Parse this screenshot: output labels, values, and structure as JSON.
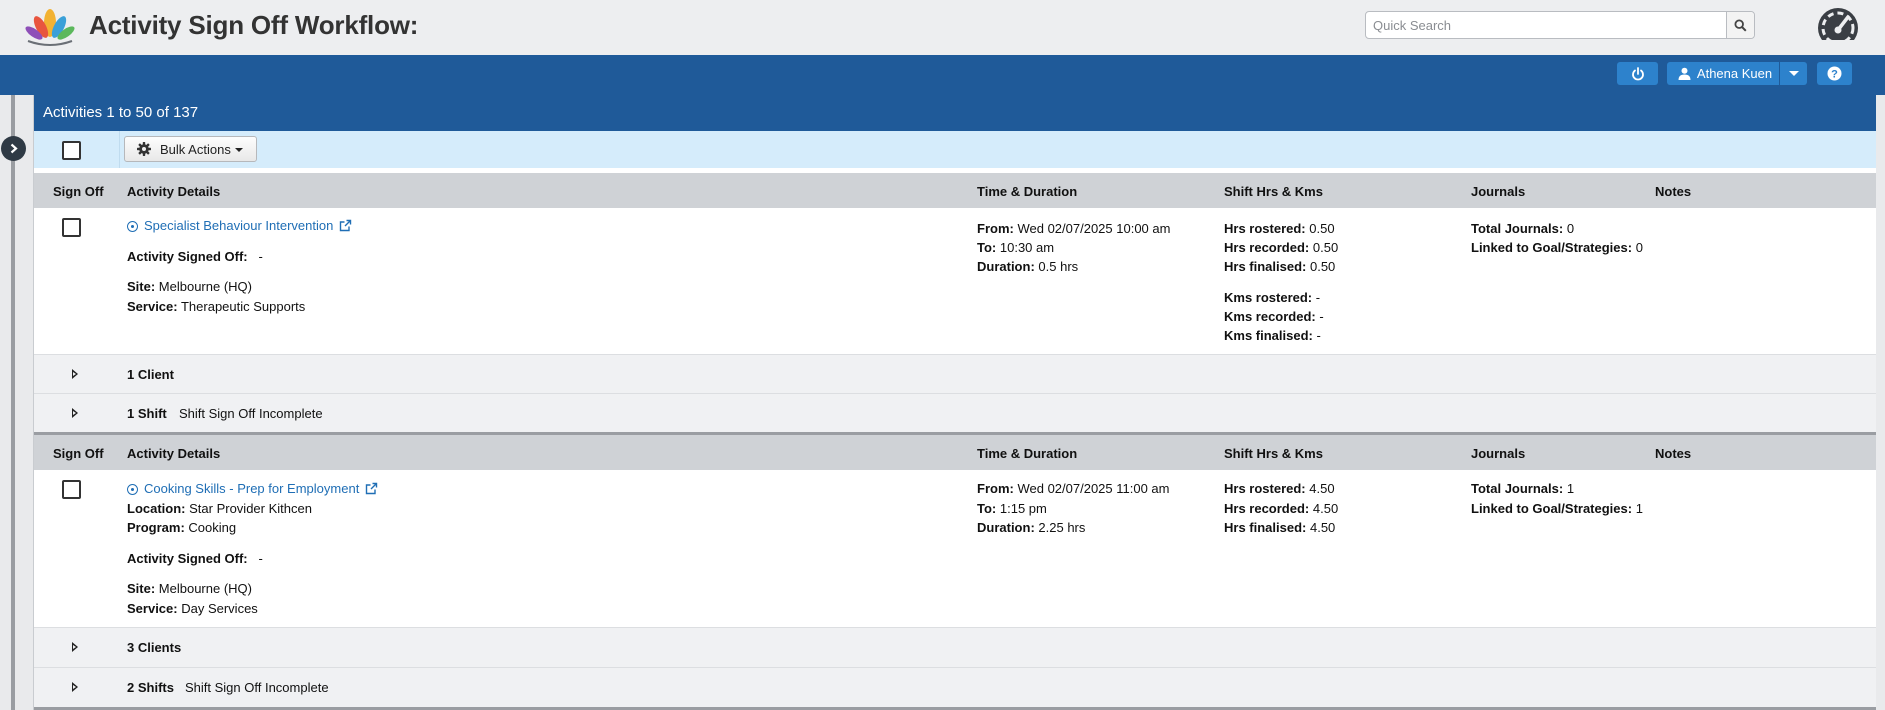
{
  "header": {
    "title": "Activity Sign Off Workflow:",
    "search_placeholder": "Quick Search",
    "logo_icon": "lotus-logo-icon",
    "dashboard_icon": "speedometer-icon"
  },
  "navbar": {
    "user_name": "Athena Kuen",
    "power_icon": "power-icon",
    "user_icon": "user-icon",
    "help_icon": "help-icon"
  },
  "panel": {
    "title": "Activities 1 to 50 of 137",
    "bulk_actions_label": "Bulk Actions"
  },
  "columns": {
    "sign_off": "Sign Off",
    "details": "Activity Details",
    "time": "Time & Duration",
    "shift": "Shift Hrs & Kms",
    "journals": "Journals",
    "notes": "Notes"
  },
  "labels": {
    "signed_off": "Activity Signed Off:",
    "site": "Site:",
    "service": "Service:",
    "location": "Location:",
    "program": "Program:",
    "from": "From:",
    "to": "To:",
    "duration": "Duration:",
    "hrs_rostered": "Hrs rostered:",
    "hrs_recorded": "Hrs recorded:",
    "hrs_finalised": "Hrs finalised:",
    "kms_rostered": "Kms rostered:",
    "kms_recorded": "Kms recorded:",
    "kms_finalised": "Kms finalised:",
    "total_journals": "Total Journals:",
    "linked_goals": "Linked to Goal/Strategies:"
  },
  "activities": [
    {
      "name": "Specialist Behaviour Intervention",
      "signed_off": "-",
      "site": "Melbourne (HQ)",
      "service": "Therapeutic Supports",
      "from": "Wed 02/07/2025 10:00 am",
      "to": "10:30 am",
      "duration": "0.5 hrs",
      "hrs_rostered": "0.50",
      "hrs_recorded": "0.50",
      "hrs_finalised": "0.50",
      "kms_rostered": "-",
      "kms_recorded": "-",
      "kms_finalised": "-",
      "total_journals": "0",
      "linked_goals": "0",
      "clients_label": "1 Client",
      "shifts_label": "1 Shift",
      "shift_status": "Shift Sign Off Incomplete"
    },
    {
      "name": "Cooking Skills - Prep for Employment",
      "location": "Star Provider Kithcen",
      "program": "Cooking",
      "signed_off": "-",
      "site": "Melbourne (HQ)",
      "service": "Day Services",
      "from": "Wed 02/07/2025 11:00 am",
      "to": "1:15 pm",
      "duration": "2.25 hrs",
      "hrs_rostered": "4.50",
      "hrs_recorded": "4.50",
      "hrs_finalised": "4.50",
      "total_journals": "1",
      "linked_goals": "1",
      "clients_label": "3 Clients",
      "shifts_label": "2 Shifts",
      "shift_status": "Shift Sign Off Incomplete"
    }
  ]
}
